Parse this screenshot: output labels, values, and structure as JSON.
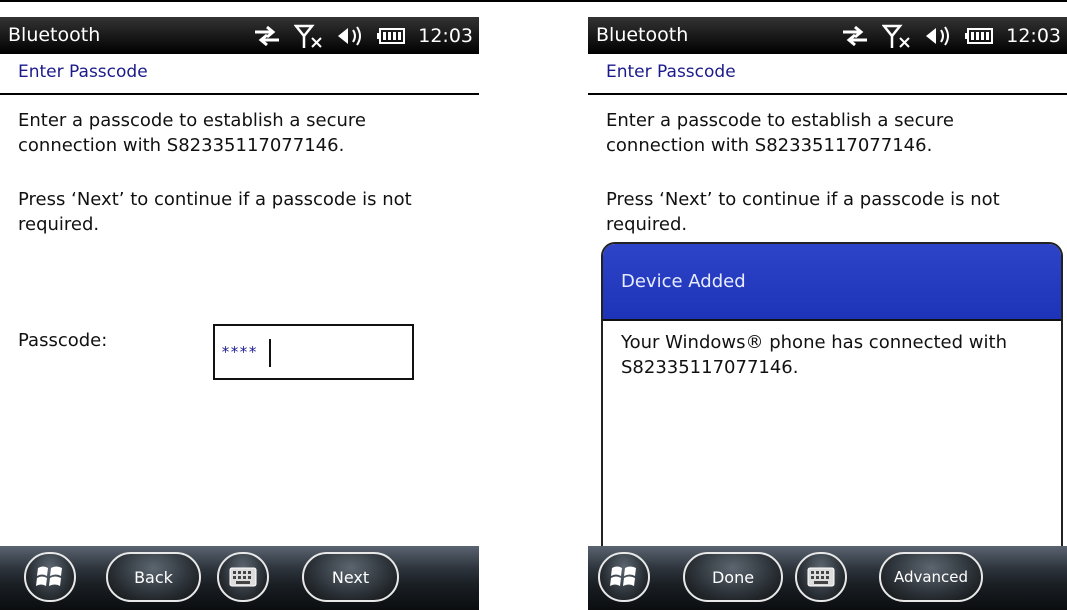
{
  "left_screen": {
    "statusbar": {
      "app_title": "Bluetooth",
      "clock": "12:03"
    },
    "page_title": "Enter Passcode",
    "body_line1": "Enter a passcode to establish a secure connection with S82335117077146.",
    "body_line2": "Press ‘Next’ to continue if a passcode is not required.",
    "passcode_label": "Passcode:",
    "passcode_value": "****",
    "softkeys": {
      "back": "Back",
      "next": "Next"
    }
  },
  "right_screen": {
    "statusbar": {
      "app_title": "Bluetooth",
      "clock": "12:03"
    },
    "page_title": "Enter Passcode",
    "body_line1": "Enter a passcode to establish a secure connection with S82335117077146.",
    "body_line2": "Press ‘Next’ to continue if a passcode is not required.",
    "dialog": {
      "title": "Device Added",
      "message": "Your Windows® phone has connected with S82335117077146."
    },
    "softkeys": {
      "done": "Done",
      "advanced": "Advanced"
    }
  },
  "icons": {
    "status": [
      "sync-arrows-icon",
      "no-signal-icon",
      "volume-icon",
      "battery-icon"
    ],
    "softbar": [
      "windows-start-icon",
      "keyboard-icon"
    ]
  },
  "colors": {
    "title_blue": "#1a1a8c",
    "dialog_header": "#1d33b8",
    "statusbar": "#000000"
  }
}
